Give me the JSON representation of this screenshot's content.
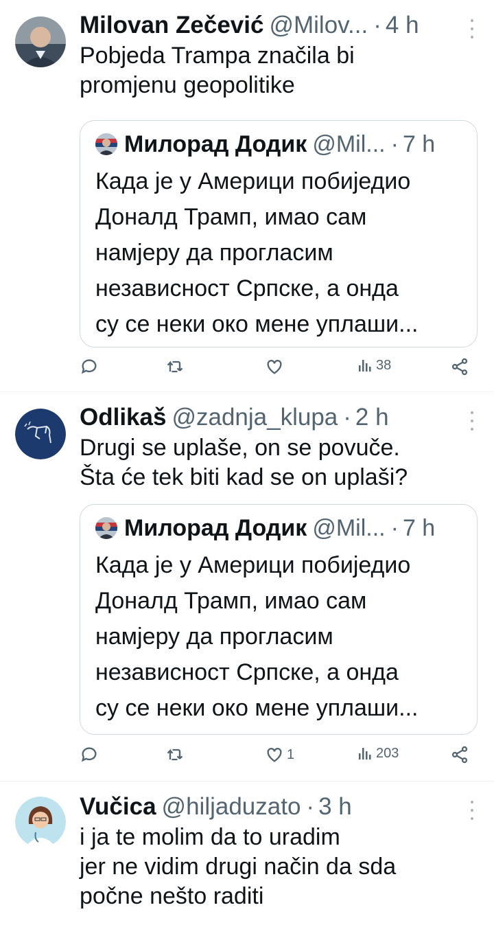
{
  "tweets": [
    {
      "author": "Milovan Zečević",
      "handle": "@Milov...",
      "time": "4 h",
      "text": "Pobjeda Trampa značila bi\npromjenu geopolitike",
      "quote": {
        "author": "Милорад Додик",
        "handle": "@Mil...",
        "time": "7 h",
        "text": "Када је у Америци побиједио\nДоналд Трамп, имао сам\nнамјеру да прогласим\nнезависност Српске, а онда\nсу се неки око мене уплаши..."
      },
      "likes": "",
      "views": "38"
    },
    {
      "author": "Odlikaš",
      "handle": "@zadnja_klupa",
      "time": "2 h",
      "text": "Drugi se uplaše, on se povuče.\nŠta će tek biti kad se on uplaši?",
      "quote": {
        "author": "Милорад Додик",
        "handle": "@Mil...",
        "time": "7 h",
        "text": "Када је у Америци побиједио\nДоналд Трамп, имао сам\nнамјеру да прогласим\nнезависност Српске, а онда\nсу се неки око мене уплаши..."
      },
      "likes": "1",
      "views": "203"
    },
    {
      "author": "Vučica",
      "handle": "@hiljaduzato",
      "time": "3 h",
      "text": "i ja te molim da to uradim\njer ne vidim drugi način da sda\npočne nešto raditi"
    }
  ],
  "colors": {
    "text": "#0f1419",
    "secondary": "#536471",
    "border": "#cfd9de",
    "divider": "#eff3f4",
    "odlikas_avatar_bg": "#1d3a6e"
  },
  "icons": [
    "reply-icon",
    "retweet-icon",
    "like-icon",
    "views-icon",
    "share-icon",
    "more-icon"
  ]
}
